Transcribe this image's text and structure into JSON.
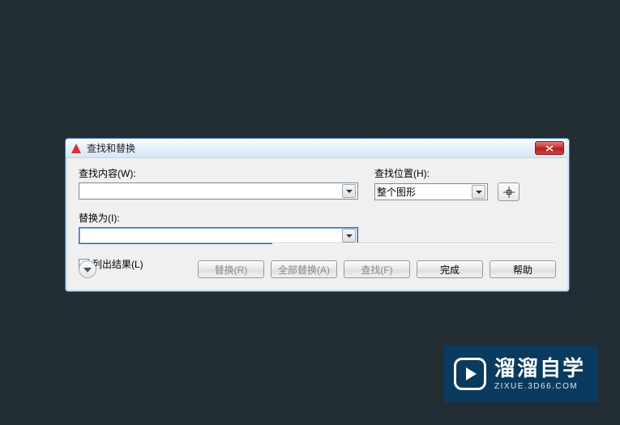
{
  "dialog": {
    "title": "查找和替换",
    "find_label": "查找内容(W):",
    "replace_label": "替换为(I):",
    "location_label": "查找位置(H):",
    "location_value": "整个图形",
    "list_results_label": "列出结果(L)",
    "find_value": "",
    "replace_value": ""
  },
  "buttons": {
    "replace": "替换(R)",
    "replace_all": "全部替换(A)",
    "find": "查找(F)",
    "done": "完成",
    "help": "帮助"
  },
  "icons": {
    "app": "autocad-triangle-icon",
    "close": "close-icon",
    "pick": "crosshair-pick-icon",
    "expand": "chevron-down-icon"
  },
  "watermark": {
    "brand": "溜溜自学",
    "url": "ZIXUE.3D66.COM"
  }
}
